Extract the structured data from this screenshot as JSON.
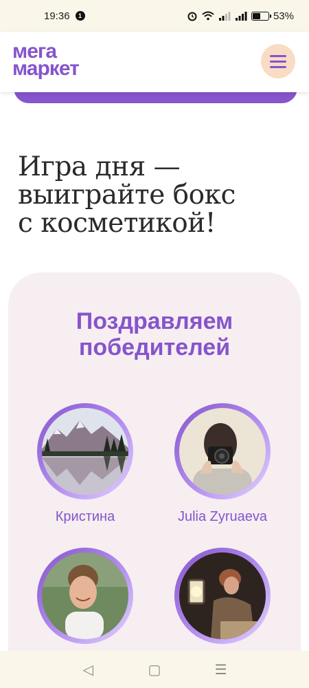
{
  "status_bar": {
    "time": "19:36",
    "notification_count": "1",
    "battery_percent": "53%",
    "battery_level": 0.53
  },
  "header": {
    "logo_line1": "мега",
    "logo_line2": "маркет",
    "brand_color": "#8654cc",
    "menu_button_color": "#f9dcc4"
  },
  "main": {
    "headline_line1": "Игра дня —",
    "headline_line2": "выиграйте бокс",
    "headline_line3": "с косметикой!"
  },
  "winners_card": {
    "title_line1": "Поздравляем",
    "title_line2": "победителей",
    "winners": [
      {
        "name": "Кристина",
        "avatar": "mountain-lake-photo"
      },
      {
        "name": "Julia Zyruaeva",
        "avatar": "person-with-camera-photo"
      },
      {
        "name": "",
        "avatar": "smiling-woman-photo"
      },
      {
        "name": "",
        "avatar": "person-with-lantern-photo"
      }
    ]
  },
  "nav_bar": {
    "back_icon": "◁",
    "home_icon": "▢",
    "menu_icon": "☰"
  }
}
